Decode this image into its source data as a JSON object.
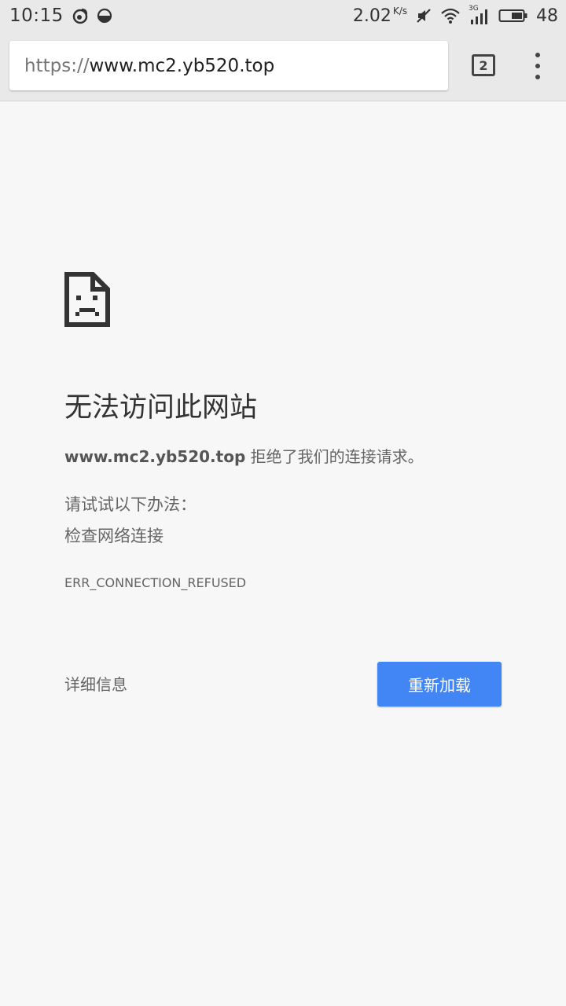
{
  "status_bar": {
    "time": "10:15",
    "net_speed": "2.02",
    "net_speed_unit": "K/s",
    "network_type": "3G",
    "battery_level": "48",
    "icons": [
      "weibo-icon",
      "half-moon-icon",
      "mute-icon",
      "wifi-icon",
      "signal-icon",
      "battery-icon"
    ]
  },
  "toolbar": {
    "url_scheme": "https://",
    "url_host": "www.mc2.yb520.top",
    "tab_count": "2",
    "menu_icon": "more-vert-icon"
  },
  "error": {
    "icon": "sad-page-icon",
    "title": "无法访问此网站",
    "host": "www.mc2.yb520.top",
    "message": " 拒绝了我们的连接请求。",
    "suggest_label": "请试试以下办法：",
    "suggest_item": "检查网络连接",
    "code": "ERR_CONNECTION_REFUSED",
    "details_label": "详细信息",
    "reload_label": "重新加载"
  },
  "colors": {
    "accent": "#4285f4",
    "background": "#f7f7f7",
    "toolbar": "#e9e9e9"
  }
}
